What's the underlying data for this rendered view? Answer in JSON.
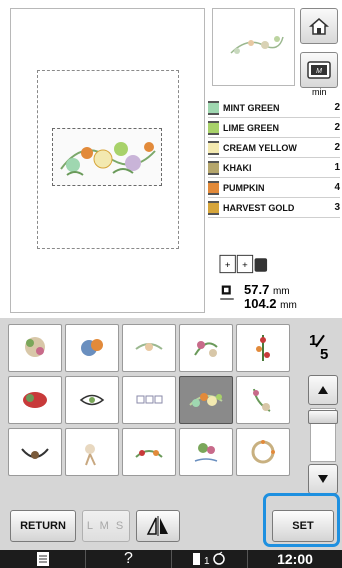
{
  "colors": {
    "accent": "#1e90e0",
    "panel_bg": "#d6d6d6",
    "status_bg": "#1c1c1c"
  },
  "icons": {
    "home": "home-icon",
    "memory": "memory-icon",
    "toggle": "display-toggle-icon",
    "size": "size-icon",
    "mirror": "mirror-icon",
    "doc": "document-icon",
    "help": "help-icon",
    "presser": "presser-foot-icon",
    "timer": "thread-cut-icon"
  },
  "threads": {
    "header": "min",
    "items": [
      {
        "name": "MINT GREEN",
        "minutes": "2",
        "color": "#9fd7b0"
      },
      {
        "name": "LIME GREEN",
        "minutes": "2",
        "color": "#a8d26a"
      },
      {
        "name": "CREAM YELLOW",
        "minutes": "2",
        "color": "#f3e9b0"
      },
      {
        "name": "KHAKI",
        "minutes": "1",
        "color": "#b5a66c"
      },
      {
        "name": "PUMPKIN",
        "minutes": "4",
        "color": "#e28a3a"
      },
      {
        "name": "HARVEST GOLD",
        "minutes": "3",
        "color": "#d6a53b"
      }
    ]
  },
  "size": {
    "height": "57.7",
    "width": "104.2",
    "unit": "mm"
  },
  "page": {
    "current": "1",
    "total": "5"
  },
  "buttons": {
    "return": "RETURN",
    "lms": "L M S",
    "set": "SET"
  },
  "status": {
    "help": "?",
    "time": "12:00"
  }
}
